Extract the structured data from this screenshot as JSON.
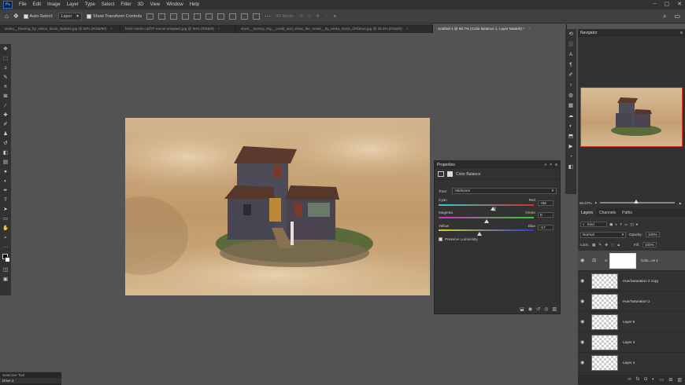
{
  "app": {
    "logo": "Ps"
  },
  "menu": [
    "File",
    "Edit",
    "Image",
    "Layer",
    "Type",
    "Select",
    "Filter",
    "3D",
    "View",
    "Window",
    "Help"
  ],
  "options": {
    "auto_select_label": "Auto-Select:",
    "auto_select_value": "Layer",
    "transform_label": "Show Transform Controls",
    "mode_label": "3D Mode:",
    "more": "···"
  },
  "tabs": [
    {
      "label": "elvino__framing_by_vision_stock_dwb6to.jpg @ 50% (RGB/8#)",
      "active": false
    },
    {
      "label": "brick-martin-cEf7F-ezmw-unsplash.jpg @ 50% (RGB/8)",
      "active": false
    },
    {
      "label": "stock__stormy_sky__credit_and_show_the_result__by_amka_stock_d781bxe.jpg @ 33.3% (RGB/8)",
      "active": false
    },
    {
      "label": "Untitled-1 @ 66.7% (Color Balance 1, Layer Mask/8) *",
      "active": true
    }
  ],
  "properties": {
    "title": "Properties",
    "adjustment": "Color Balance",
    "tone_label": "Tone:",
    "tone_value": "Midtones",
    "sliders": [
      {
        "left": "Cyan",
        "right": "Red",
        "value": "+56",
        "pos": 0.57,
        "grad": [
          "#2ad0d6",
          "#d62a2a"
        ]
      },
      {
        "left": "Magenta",
        "right": "Green",
        "value": "0",
        "pos": 0.5,
        "grad": [
          "#d62ad0",
          "#2ad62a"
        ]
      },
      {
        "left": "Yellow",
        "right": "Blue",
        "value": "-17",
        "pos": 0.43,
        "grad": [
          "#d6d22a",
          "#2a3ad6"
        ]
      }
    ],
    "preserve_label": "Preserve Luminosity"
  },
  "navigator": {
    "title": "Navigator",
    "zoom": "66.67%"
  },
  "layers": {
    "tabs": [
      "Layers",
      "Channels",
      "Paths"
    ],
    "kind": "Kind",
    "blend": "Normal",
    "opacity_label": "Opacity:",
    "opacity": "100%",
    "lock_label": "Lock:",
    "fill_label": "Fill:",
    "fill": "100%",
    "items": [
      {
        "name": "Colo...ce 1",
        "selected": true
      },
      {
        "name": "Hue/Saturation 2 copy",
        "selected": false
      },
      {
        "name": "Hue/Saturation 2",
        "selected": false
      },
      {
        "name": "Layer 5",
        "selected": false
      },
      {
        "name": "Layer 4",
        "selected": false
      },
      {
        "name": "Layer 4",
        "selected": false
      }
    ]
  },
  "bottom_panel": {
    "line1": "Selective Tool",
    "line2": "Drive 2"
  }
}
